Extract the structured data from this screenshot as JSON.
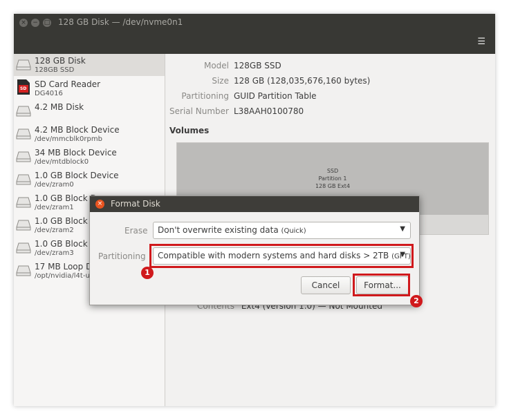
{
  "window": {
    "title": "128 GB Disk — /dev/nvme0n1"
  },
  "window_controls": {
    "close": "×",
    "minimize": "−",
    "maximize": "□"
  },
  "menu_icon": "☰",
  "sidebar": {
    "items": [
      {
        "name": "128 GB Disk",
        "sub": "128GB SSD",
        "icon": "hard-disk-icon",
        "selected": true
      },
      {
        "name": "SD Card Reader",
        "sub": "DG4016",
        "icon": "sd-card-icon",
        "icon_text": "SD"
      },
      {
        "name": "4.2 MB Disk",
        "sub": "",
        "icon": "hard-disk-icon"
      },
      {
        "name": "4.2 MB Block Device",
        "sub": "/dev/mmcblk0rpmb",
        "icon": "hard-disk-icon"
      },
      {
        "name": "34 MB Block Device",
        "sub": "/dev/mtdblock0",
        "icon": "hard-disk-icon"
      },
      {
        "name": "1.0 GB Block Device",
        "sub": "/dev/zram0",
        "icon": "hard-disk-icon"
      },
      {
        "name": "1.0 GB Block D",
        "sub": "/dev/zram1",
        "icon": "hard-disk-icon"
      },
      {
        "name": "1.0 GB Block D",
        "sub": "/dev/zram2",
        "icon": "hard-disk-icon"
      },
      {
        "name": "1.0 GB Block D",
        "sub": "/dev/zram3",
        "icon": "hard-disk-icon"
      },
      {
        "name": "17 MB Loop D",
        "sub": "/opt/nvidia/l4t-u",
        "icon": "hard-disk-icon"
      }
    ]
  },
  "details": {
    "properties": [
      {
        "label": "Model",
        "value": "128GB SSD"
      },
      {
        "label": "Size",
        "value": "128 GB (128,035,676,160 bytes)"
      },
      {
        "label": "Partitioning",
        "value": "GUID Partition Table"
      },
      {
        "label": "Serial Number",
        "value": "L38AAH0100780"
      }
    ],
    "volumes_heading": "Volumes",
    "volume": {
      "line1": "SSD",
      "line2": "Partition 1",
      "line3": "128 GB Ext4"
    },
    "contents": {
      "label": "Contents",
      "value": "Ext4 (version 1.0) — Not Mounted"
    }
  },
  "dialog": {
    "title": "Format Disk",
    "close_glyph": "×",
    "erase_label": "Erase",
    "erase_value": "Don't overwrite existing data",
    "erase_hint": "(Quick)",
    "partitioning_label": "Partitioning",
    "partitioning_value": "Compatible with modern systems and hard disks > 2TB",
    "partitioning_hint": "(GPT)",
    "cancel_label": "Cancel",
    "format_label": "Format...",
    "dropdown_arrow": "▼"
  },
  "annotations": {
    "badge_1": "1",
    "badge_2": "2",
    "highlight_color": "#d0191c"
  },
  "colors": {
    "titlebar": "#383834",
    "accent_close": "#e95420",
    "selected_row": "#dedcd9"
  }
}
